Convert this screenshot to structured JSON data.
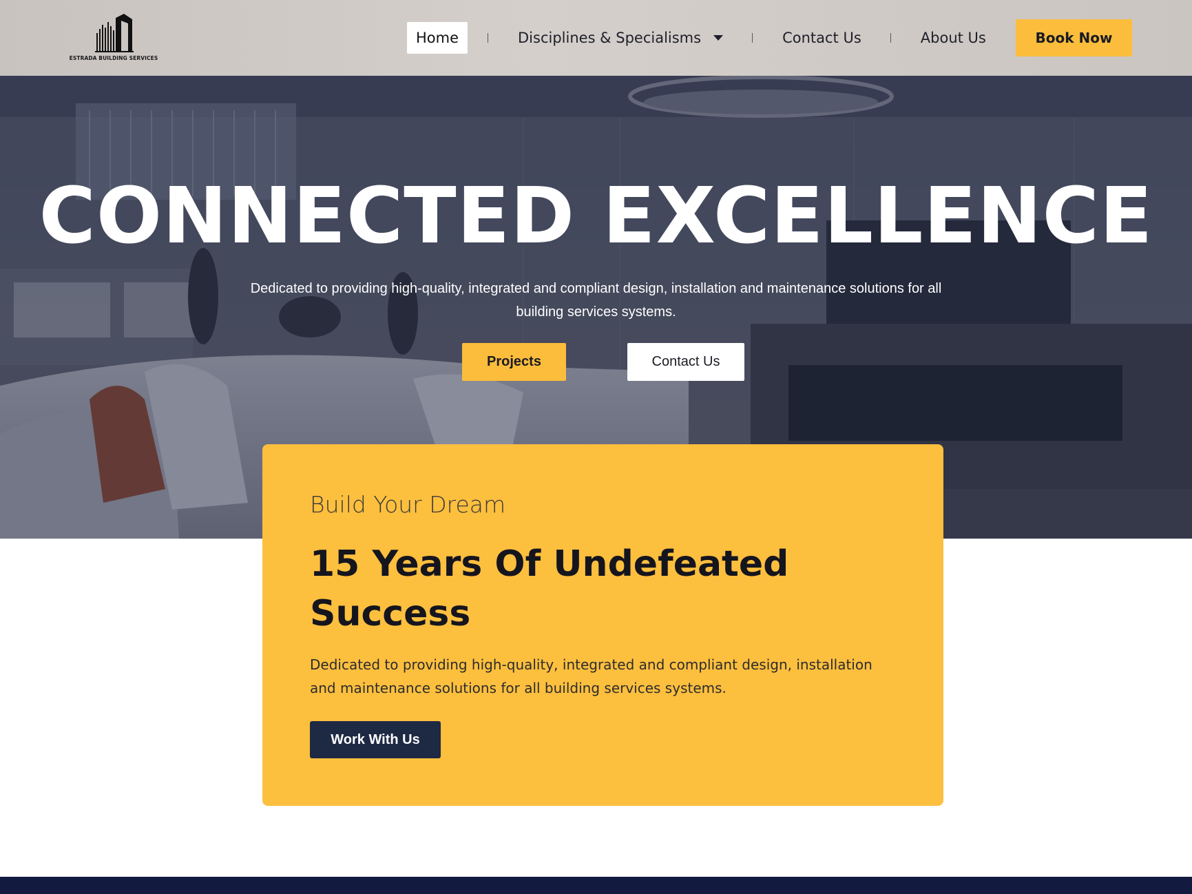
{
  "brand": {
    "name": "ESTRADA BUILDING SERVICES"
  },
  "nav": {
    "home": "Home",
    "disciplines": "Disciplines & Specialisms",
    "contact": "Contact Us",
    "about": "About Us",
    "book": "Book Now"
  },
  "hero": {
    "title": "CONNECTED EXCELLENCE",
    "subtitle": "Dedicated to providing high-quality, integrated and compliant design, installation and maintenance solutions for all building services systems.",
    "projects_label": "Projects",
    "contact_label": "Contact Us"
  },
  "card": {
    "kicker": "Build Your Dream",
    "title": "15 Years Of Undefeated Success",
    "text": "Dedicated to providing high-quality, integrated and compliant design, installation and maintenance solutions for all building services systems.",
    "button": "Work With Us"
  },
  "colors": {
    "accent": "#fbbd3b",
    "dark": "#1e2a44",
    "footer": "#131a3f"
  }
}
